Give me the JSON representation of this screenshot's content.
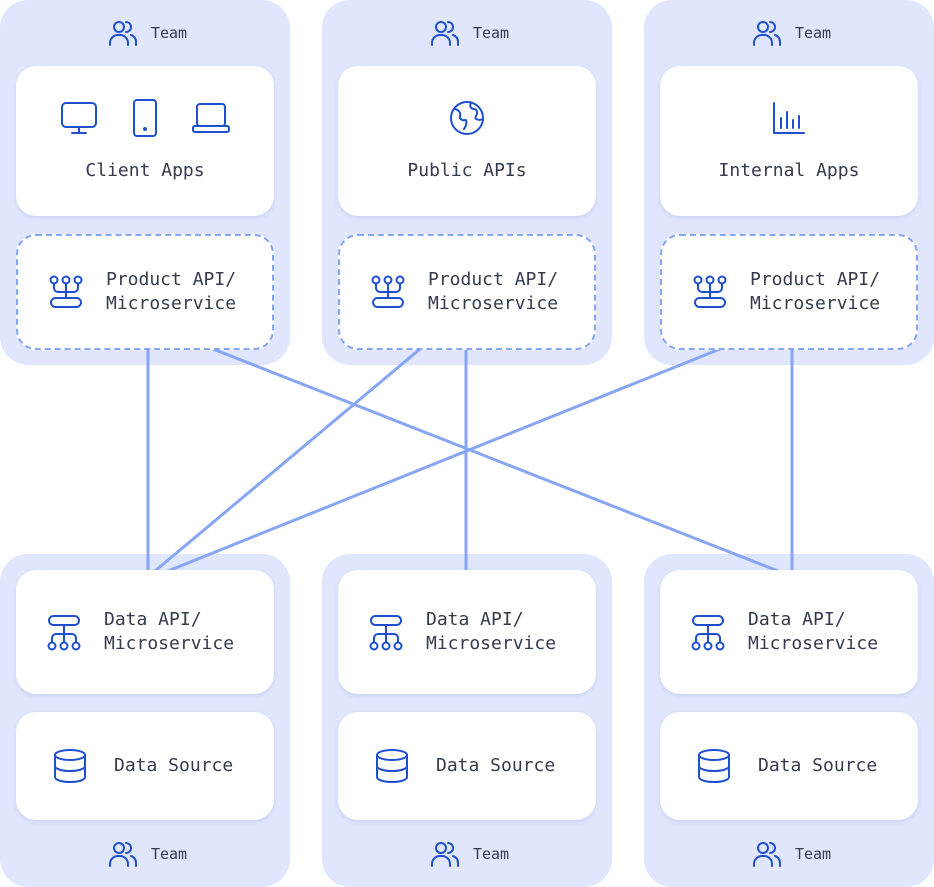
{
  "colors": {
    "panel": "#dfe6fd",
    "connector": "#86a6f5",
    "icon": "#1d4fcf"
  },
  "columns": [
    {
      "top_team": "Team",
      "consumer": {
        "title": "Client Apps",
        "icons": [
          "monitor-icon",
          "tablet-icon",
          "laptop-icon"
        ]
      },
      "product_api": "Product API/\nMicroservice",
      "data_api": "Data API/\nMicroservice",
      "data_source": "Data Source",
      "bottom_team": "Team"
    },
    {
      "top_team": "Team",
      "consumer": {
        "title": "Public APIs",
        "icons": [
          "globe-icon"
        ]
      },
      "product_api": "Product API/\nMicroservice",
      "data_api": "Data API/\nMicroservice",
      "data_source": "Data Source",
      "bottom_team": "Team"
    },
    {
      "top_team": "Team",
      "consumer": {
        "title": "Internal Apps",
        "icons": [
          "bar-chart-icon"
        ]
      },
      "product_api": "Product API/\nMicroservice",
      "data_api": "Data API/\nMicroservice",
      "data_source": "Data Source",
      "bottom_team": "Team"
    }
  ],
  "connections": [
    [
      0,
      0
    ],
    [
      0,
      2
    ],
    [
      1,
      0
    ],
    [
      1,
      1
    ],
    [
      2,
      0
    ],
    [
      2,
      2
    ]
  ]
}
